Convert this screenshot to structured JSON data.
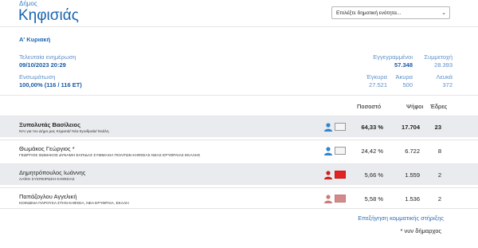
{
  "header": {
    "municipality_label": "Δήμος",
    "municipality_name": "Κηφισιάς",
    "unit_select": {
      "selected": "Επιλέξτε δημοτική ενότητα..."
    }
  },
  "round": "Α' Κυριακή",
  "stats": {
    "last_update_label": "Τελευταία ενημέρωση",
    "last_update_value": "09/10/2023 20:29",
    "integration_label": "Ενσωμάτωση",
    "integration_value": "100,00% (116 / 116 ΕΤ)",
    "registered_label": "Εγγεγραμμένοι",
    "registered_value": "57.348",
    "turnout_label": "Συμμετοχή",
    "turnout_value": "28.393",
    "valid_label": "Έγκυρα",
    "valid_value": "27.521",
    "invalid_label": "Άκυρα",
    "invalid_value": "500",
    "blank_label": "Λευκά",
    "blank_value": "372"
  },
  "table": {
    "headers": {
      "percent": "Ποσοστό",
      "votes": "Ψήφοι",
      "seats": "Έδρες"
    },
    "rows": [
      {
        "name": "Ξυπολυτάς Βασίλειος",
        "party": "ΝΑΙ για τον Δήμο μας Κηφισιά/ Νέα Ερυθραία/ Εκάλη",
        "percent": "64,33 %",
        "votes": "17.704",
        "seats": "23",
        "color": "#2e86d0",
        "box_fill": "#f5f5f5"
      },
      {
        "name": "Θωμάκος Γεώργιος *",
        "party": "ΓΕΩΡΓΙΟΣ ΘΩΜΑΚΟΣ ΔΥΝΑΜΗ ΕΛΠΙΔΑΣ ΣΥΜΜΑΧΙΑ ΠΟΛΙΤΩΝ ΚΗΦΙΣΙΑΣ ΝΕΑΣ ΕΡΥΘΡΑΙΑΣ ΕΚΑΛΗΣ",
        "percent": "24,42 %",
        "votes": "6.722",
        "seats": "8",
        "color": "#2e86d0",
        "box_fill": "#f5f5f5"
      },
      {
        "name": "Δημητρόπουλος Ιωάννης",
        "party": "ΛΑΪΚΗ ΣΥΣΠΕΙΡΩΣΗ ΚΗΦΙΣΙΑΣ",
        "percent": "5,66 %",
        "votes": "1.559",
        "seats": "2",
        "color": "#d11f1f",
        "box_fill": "#e52222"
      },
      {
        "name": "Παπάζογλου Αγγελική",
        "party": "ΚΟΙΝΩΝΙΑ ΠΑΡΟΥΣΑ ΣΤΗΝ ΚΗΦΙΣΙΑ, ΝΕΑ ΕΡΥΘΡΑΙΑ, ΕΚΑΛΗ",
        "percent": "5,58 %",
        "votes": "1.536",
        "seats": "2",
        "color": "#c97b7b",
        "box_fill": "#d48a8a"
      }
    ]
  },
  "support_link": "Επεξήγηση κομματικής στήριξης",
  "mayor_note": "* νυν δήμαρχος",
  "icons": {
    "candidate": "person-icon",
    "select": "chevron-down-icon"
  }
}
